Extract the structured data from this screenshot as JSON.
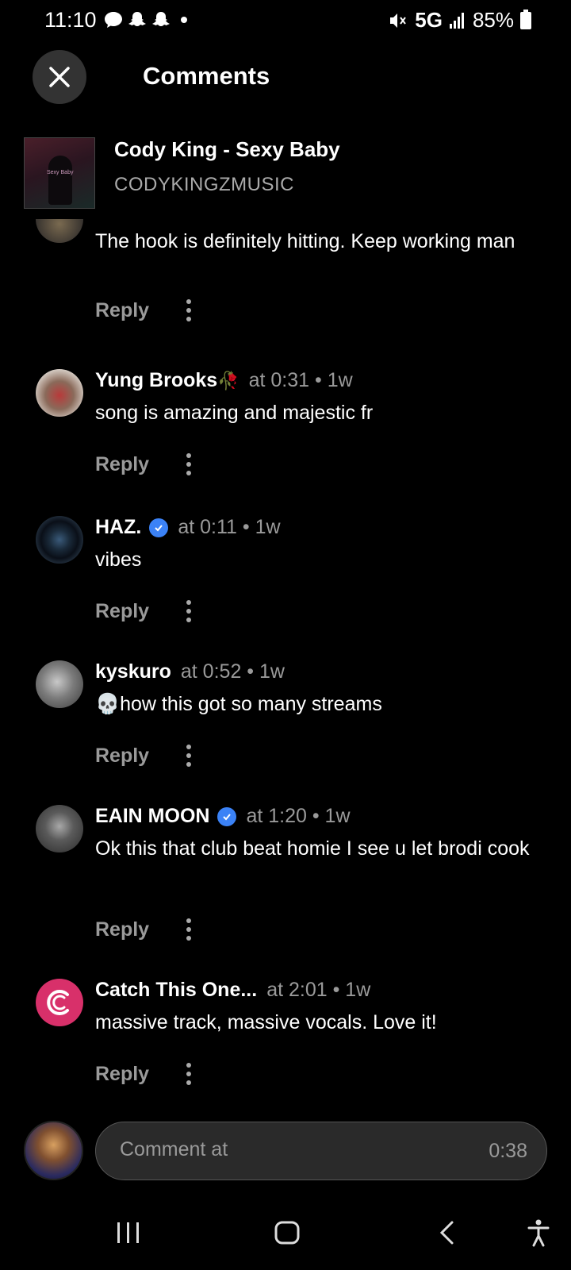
{
  "status_bar": {
    "time": "11:10",
    "network": "5G",
    "battery": "85%"
  },
  "header": {
    "title": "Comments",
    "close_icon": "close-icon"
  },
  "track": {
    "title": "Cody King - Sexy Baby",
    "artist": "CODYKINGZMUSIC",
    "art_text": "Sexy Baby"
  },
  "comments": [
    {
      "user": "",
      "meta": "",
      "text": "The hook is definitely hitting. Keep working man",
      "reply_label": "Reply",
      "verified": false
    },
    {
      "user": "Yung Brooks",
      "emoji": "🥀",
      "meta": "at 0:31 • 1w",
      "text": "song is amazing and majestic fr",
      "reply_label": "Reply",
      "verified": false
    },
    {
      "user": "HAZ.",
      "meta": "at 0:11 • 1w",
      "text": "vibes",
      "reply_label": "Reply",
      "verified": true
    },
    {
      "user": "kyskuro",
      "meta": "at 0:52 • 1w",
      "text": "💀how this got so many streams",
      "reply_label": "Reply",
      "verified": false
    },
    {
      "user": "EAIN MOON",
      "meta": "at 1:20 • 1w",
      "text": "Ok this that club beat homie I see u let brodi cook",
      "reply_label": "Reply",
      "verified": true
    },
    {
      "user": "Catch This One...",
      "meta": "at 2:01 • 1w",
      "text": "massive track, massive vocals. Love it!",
      "reply_label": "Reply",
      "verified": false
    }
  ],
  "comment_input": {
    "placeholder": "Comment at",
    "time": "0:38"
  },
  "colors": {
    "background": "#000000",
    "verified": "#3b82f6",
    "muted": "#9a9a9a"
  }
}
